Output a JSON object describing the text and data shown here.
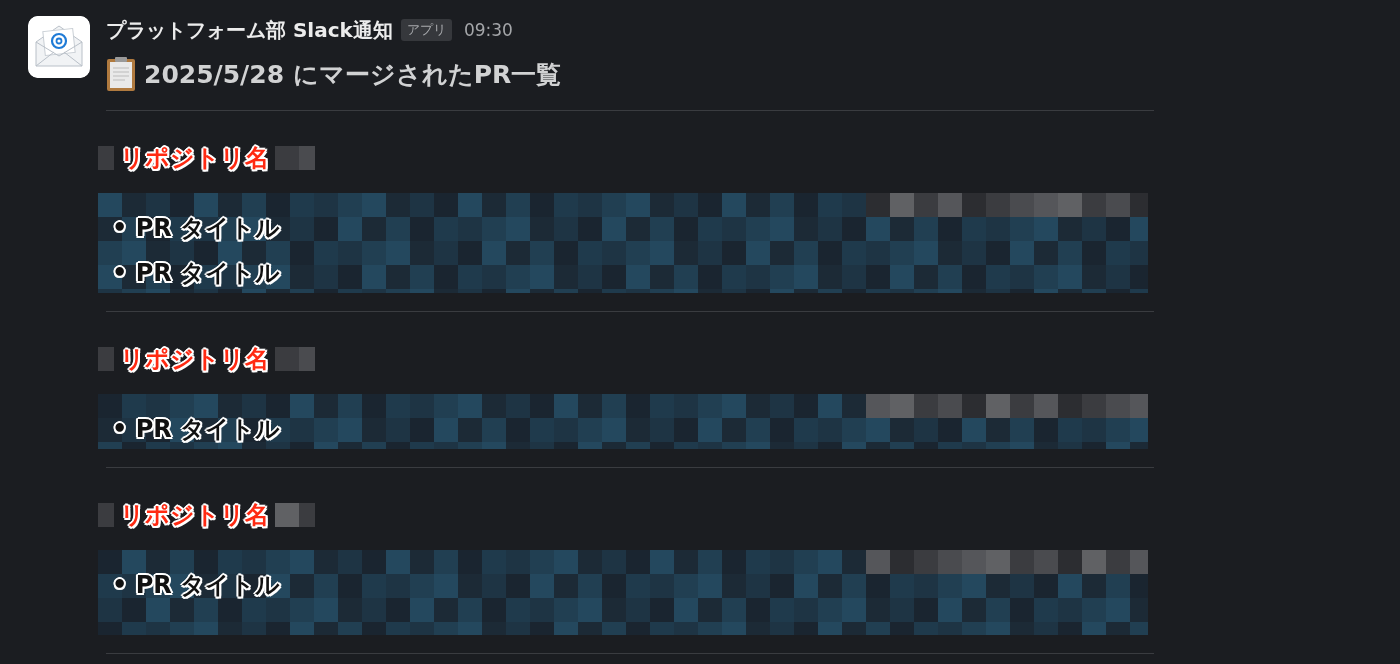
{
  "message": {
    "sender": "プラットフォーム部 Slack通知",
    "badge": "アプリ",
    "time": "09:30",
    "title": "2025/5/28 にマージされたPR一覧"
  },
  "sections": [
    {
      "repo_label": "リポジトリ名",
      "items": [
        "• PR タイトル",
        "• PR タイトル"
      ]
    },
    {
      "repo_label": "リポジトリ名",
      "items": [
        "• PR タイトル"
      ]
    },
    {
      "repo_label": "リポジトリ名",
      "items": [
        "• PR タイトル"
      ]
    }
  ]
}
